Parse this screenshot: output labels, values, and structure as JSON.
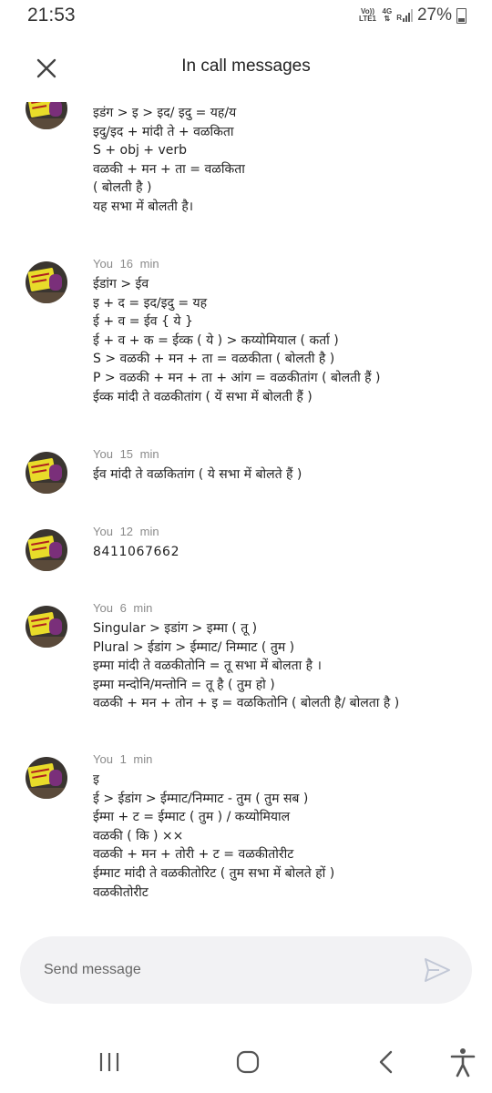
{
  "status_bar": {
    "time": "21:53",
    "volte": "Vo)) LTE1",
    "network": "4G",
    "roaming": "R",
    "battery": "27%"
  },
  "header": {
    "title": "In call messages",
    "close_icon": "close-icon"
  },
  "messages": [
    {
      "sender": "",
      "time": "",
      "lines": [
        "इडंग > इ > इद/ इदु = यह/य",
        "इदु/इद + मांदी ते + वळकिता",
        "S  +  obj + verb",
        "वळकी + मन + ता = वळकिता",
        "( बोलती है )",
        "यह सभा में बोलती है।"
      ]
    },
    {
      "sender": "You",
      "time": "16 min",
      "lines": [
        "ईडांग > ईव",
        "इ + द = इद/इदु = यह",
        "ई + व = ईव { ये }",
        "ई + व + क = ईव्क ( ये ) > कय्योमियाल ( कर्ता )",
        "S > वळकी + मन + ता = वळकीता ( बोलती है )",
        "P > वळकी + मन + ता + आंग = वळकीतांग ( बोलती हैं )",
        "ईव्क मांदी ते वळकीतांग ( यें सभा में बोलती हैं )"
      ]
    },
    {
      "sender": "You",
      "time": "15 min",
      "lines": [
        "ईव मांदी ते वळकितांग ( ये सभा में बोलते हैं )"
      ]
    },
    {
      "sender": "You",
      "time": "12 min",
      "lines": [
        "8411067662"
      ]
    },
    {
      "sender": "You",
      "time": "6 min",
      "lines": [
        "Singular > इडांग > इम्मा ( तू )",
        "Plural > ईडांग > ईम्माट/ निम्माट ( तुम )",
        "इम्मा मांदी ते वळकीतोनि = तू सभा में बोलता है ।",
        "इम्मा मन्दोनि/मन्तोनि = तू है ( तुम हो )",
        "वळकी + मन + तोन + इ = वळकितोनि ( बोलती है/ बोलता है )"
      ]
    },
    {
      "sender": "You",
      "time": "1 min",
      "lines": [
        "इ",
        "ई > ईडांग > ईम्माट/निम्माट - तुम ( तुम सब )",
        "ईम्मा + ट = ईम्माट ( तुम ) / कय्योमियाल",
        "वळकी ( कि ) ××",
        "वळकी + मन + तोरी + ट = वळकीतोरीट",
        "ईम्माट मांदी ते वळकीतोरिट ( तुम सभा में बोलते हों )",
        "वळकीतोरीट"
      ]
    }
  ],
  "composer": {
    "placeholder": "Send message",
    "send_icon": "send-icon"
  },
  "nav_bar": [
    "recent-apps-icon",
    "home-icon",
    "back-icon",
    "accessibility-icon"
  ]
}
